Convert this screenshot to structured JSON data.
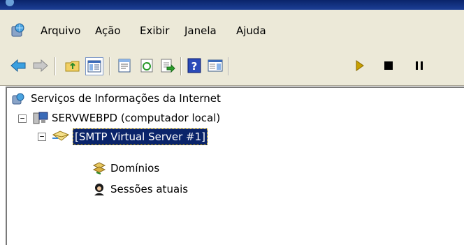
{
  "menu": {
    "items": [
      "Arquivo",
      "Ação",
      "Exibir",
      "Janela",
      "Ajuda"
    ]
  },
  "toolbar": {
    "buttons": [
      {
        "icon": "back-arrow-icon"
      },
      {
        "icon": "forward-arrow-icon"
      },
      {
        "icon": "up-folder-icon"
      },
      {
        "icon": "show-hide-console-tree-icon"
      },
      {
        "icon": "properties-icon"
      },
      {
        "icon": "refresh-icon"
      },
      {
        "icon": "export-list-icon"
      },
      {
        "icon": "help-icon"
      },
      {
        "icon": "action-pane-icon"
      },
      {
        "icon": "start-icon"
      },
      {
        "icon": "stop-icon"
      },
      {
        "icon": "pause-icon"
      }
    ],
    "highlight_color": "#f5f500"
  },
  "tree": {
    "root": "Serviços de Informações da Internet",
    "server": "SERVWEBPD (computador local)",
    "virtual_server": "[SMTP Virtual Server #1]",
    "children": [
      "Domínios",
      "Sessões atuais"
    ]
  },
  "colors": {
    "selection_bg": "#0a246a",
    "chrome_bg": "#ece9d8"
  }
}
